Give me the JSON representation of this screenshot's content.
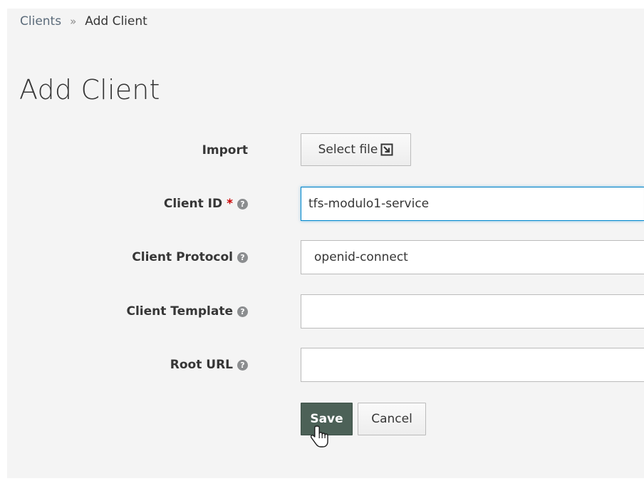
{
  "breadcrumb": {
    "parent": "Clients",
    "separator": "»",
    "current": "Add Client"
  },
  "page": {
    "title": "Add Client"
  },
  "form": {
    "import": {
      "label": "Import",
      "button_label": "Select file"
    },
    "client_id": {
      "label": "Client ID",
      "required_mark": "*",
      "value": "tfs-modulo1-service"
    },
    "client_protocol": {
      "label": "Client Protocol",
      "selected": "openid-connect"
    },
    "client_template": {
      "label": "Client Template",
      "selected": ""
    },
    "root_url": {
      "label": "Root URL",
      "value": ""
    },
    "help_glyph": "?",
    "actions": {
      "save_label": "Save",
      "cancel_label": "Cancel"
    }
  },
  "icons": {
    "help": "question-circle-icon",
    "upload": "upload-icon",
    "cursor": "hand-pointer-icon"
  },
  "colors": {
    "panel_bg": "#f4f4f4",
    "primary_button": "#4c6157",
    "focus_border": "#0088ce",
    "required": "#cc0000"
  }
}
